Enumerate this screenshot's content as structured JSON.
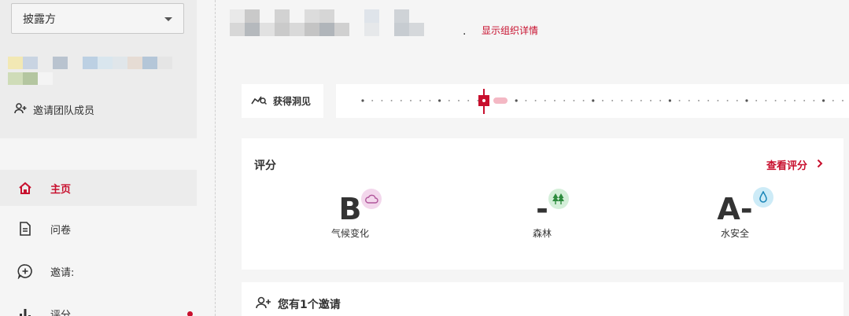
{
  "sidebar": {
    "discloser_select": {
      "value": "披露方"
    },
    "invite_team_label": "邀请团队成员",
    "nav": [
      {
        "label": "主页",
        "icon": "home-icon",
        "active": true
      },
      {
        "label": "问卷",
        "icon": "document-icon",
        "active": false
      },
      {
        "label": "邀请:",
        "icon": "chat-add-icon",
        "active": false
      },
      {
        "label": "评分",
        "icon": "bar-chart-icon",
        "active": false
      }
    ],
    "accent_color": "#c8102e"
  },
  "header": {
    "period": ".",
    "show_org_details_label": "显示组织详情"
  },
  "insights": {
    "button_label": "获得洞见"
  },
  "scores": {
    "title": "评分",
    "view_scores_label": "查看评分",
    "items": [
      {
        "grade": "B",
        "label": "气候变化",
        "icon": "cloud-icon",
        "badge_color": "#f3d7ec"
      },
      {
        "grade": "-",
        "label": "森林",
        "icon": "tree-icon",
        "badge_color": "#d4efd9"
      },
      {
        "grade": "A-",
        "label": "水安全",
        "icon": "water-drop-icon",
        "badge_color": "#cdebf7"
      }
    ]
  },
  "invitations": {
    "title": "您有1个邀请"
  }
}
